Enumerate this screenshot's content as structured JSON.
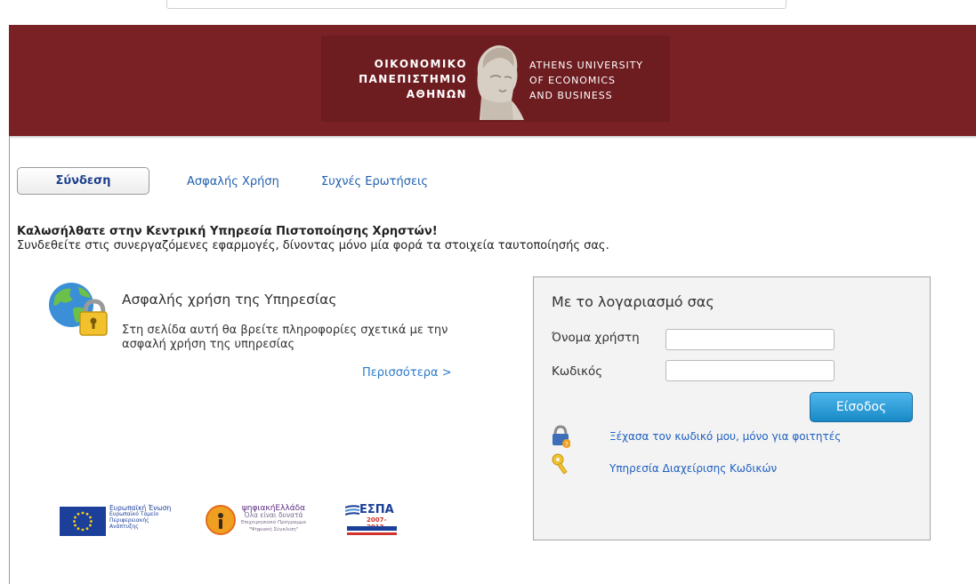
{
  "header": {
    "logo_gr_lines": [
      "ΟΙΚΟΝΟΜΙΚΟ",
      "ΠΑΝΕΠΙΣΤΗΜΙΟ",
      "ΑΘΗΝΩΝ"
    ],
    "logo_en_lines": [
      "ATHENS UNIVERSITY",
      "OF ECONOMICS",
      "AND BUSINESS"
    ],
    "bg_color": "#7a2125"
  },
  "tabs": {
    "login": "Σύνδεση",
    "secure_use": "Ασφαλής Χρήση",
    "faq": "Συχνές Ερωτήσεις"
  },
  "welcome": {
    "title": "Καλωσήλθατε στην Κεντρική Υπηρεσία Πιστοποίησης Χρηστών!",
    "subtitle": "Συνδεθείτε στις συνεργαζόμενες εφαρμογές, δίνοντας μόνο μία φορά τα στοιχεία ταυτοποίησής σας."
  },
  "secure_block": {
    "title": "Ασφαλής χρήση της Υπηρεσίας",
    "text": "Στη σελίδα αυτή θα βρείτε πληροφορίες σχετικά με την ασφαλή χρήση της υπηρεσίας",
    "more_link": "Περισσότερα >"
  },
  "login": {
    "title": "Με το λογαριασμό σας",
    "username_label": "Όνομα χρήστη",
    "username_value": "",
    "password_label": "Κωδικός",
    "password_value": "",
    "submit_label": "Είσοδος",
    "forgot_link": "Ξέχασα τον κωδικό μου, μόνο για φοιτητές",
    "manage_link": "Υπηρεσία Διαχείρισης Κωδικών",
    "button_color": "#1889c6"
  },
  "footer_logos": {
    "eu_lines": [
      "Ευρωπαϊκή Ένωση",
      "Ευρωπαϊκό Ταμείο",
      "Περιφερειακής",
      "Ανάπτυξης"
    ],
    "digital_lines": [
      "ψηφιακήΕλλάδα",
      "Όλα είναι δυνατά",
      "Επιχειρησιακό Πρόγραμμα",
      "\"Ψηφιακή Σύγκλιση\""
    ],
    "espa_title": "ΕΣΠΑ",
    "espa_years": "2007-2013"
  }
}
